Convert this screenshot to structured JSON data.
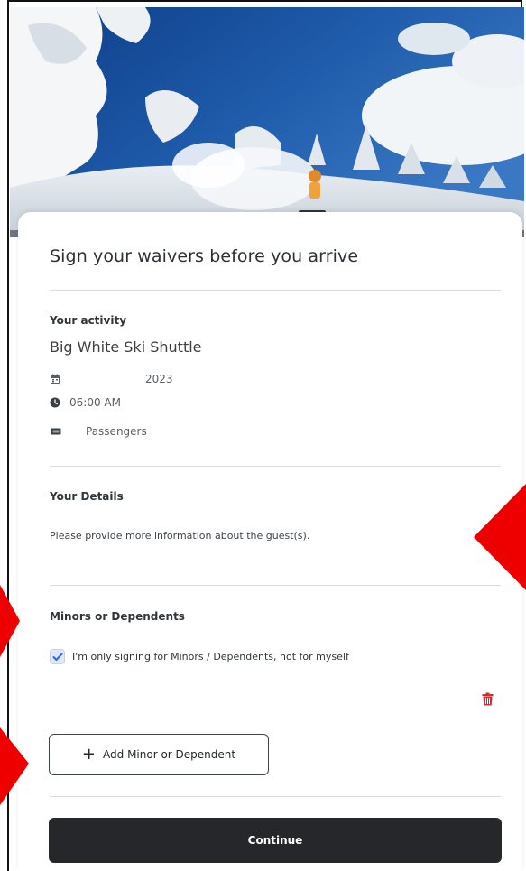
{
  "page": {
    "title": "Sign your waivers before you arrive"
  },
  "activity": {
    "section_label": "Your activity",
    "name": "Big White Ski Shuttle",
    "date": "2023",
    "time": "06:00 AM",
    "passengers": "Passengers",
    "icons": {
      "date": "calendar-icon",
      "time": "clock-icon",
      "passengers": "ticket-icon"
    }
  },
  "details": {
    "section_label": "Your Details",
    "description": "Please provide more information about the guest(s)."
  },
  "minors": {
    "section_label": "Minors or Dependents",
    "checkbox_label": "I'm only signing for Minors / Dependents, not for myself",
    "checkbox_checked": true,
    "delete_icon": "trash-icon",
    "add_button_label": "Add Minor or Dependent"
  },
  "footer": {
    "continue_label": "Continue"
  },
  "colors": {
    "primary_button": "#25272b",
    "checkbox_accent": "#2563eb",
    "delete": "#d62b2b",
    "annotation_arrow": "#ee0000"
  }
}
